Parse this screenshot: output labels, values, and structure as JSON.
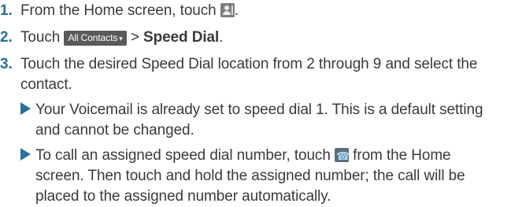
{
  "steps": [
    {
      "number": "1.",
      "text": "From the Home screen, touch",
      "icon": "contacts-app-icon",
      "trailing": "."
    },
    {
      "number": "2.",
      "prefix": "Touch",
      "chip_label": "All Contacts",
      "separator": ">",
      "bold": "Speed Dial",
      "trailing": "."
    },
    {
      "number": "3.",
      "line1": "Touch the desired Speed Dial location from 2 through 9 and select the",
      "line2": "contact."
    }
  ],
  "notes": [
    {
      "line1": "Your Voicemail is already set to speed dial 1. This is a default setting",
      "line2": "and cannot be changed."
    },
    {
      "prefix": "To call an assigned speed dial number, touch",
      "icon": "phone-app-icon",
      "suffix": "from the Home",
      "line2": "screen. Then touch and hold the assigned number; the call will be",
      "line3": "placed to the assigned number automatically."
    }
  ],
  "colors": {
    "number": "#2b6f9b",
    "bullet": "#2b6f9b",
    "text": "#3a3a3a"
  }
}
